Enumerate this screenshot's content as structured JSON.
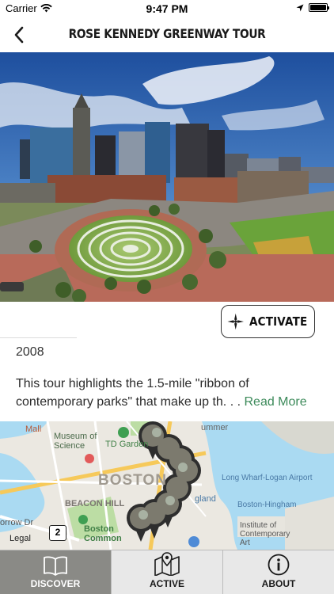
{
  "status_bar": {
    "carrier": "Carrier",
    "time": "9:47 PM",
    "battery_level": 1.0
  },
  "nav": {
    "title": "ROSE KENNEDY GREENWAY TOUR",
    "back_icon": "chevron-left-icon"
  },
  "hero": {
    "icon": "photo"
  },
  "actions": {
    "activate_label": "ACTIVATE",
    "activate_icon": "compass-icon"
  },
  "tour": {
    "year": "2008",
    "description": "This tour highlights the 1.5-mile \"ribbon of contemporary parks\" that make up th. . .",
    "read_more": "Read More"
  },
  "map": {
    "labels": {
      "mall": "Mall",
      "museum_of_science": "Museum of\nScience",
      "td_garden": "TD Garden",
      "boston": "BOSTON",
      "beacon_hill": "BEACON HILL",
      "long_wharf": "Long Wharf-Logan Airport",
      "boston_hingham": "Boston-Hingham",
      "england": "gland",
      "boston_common": "Boston\nCommon",
      "institute": "Institute of\nContemporary\nArt",
      "morrow": "orrow Dr",
      "summer": "ummer",
      "legal": "Legal"
    },
    "cluster_count": "2"
  },
  "tabs": [
    {
      "label": "DISCOVER",
      "icon": "book-icon",
      "selected": true
    },
    {
      "label": "ACTIVE",
      "icon": "map-pin-icon",
      "selected": false
    },
    {
      "label": "ABOUT",
      "icon": "info-icon",
      "selected": false
    }
  ],
  "colors": {
    "accent_green": "#3c8a5a",
    "tab_selected": "#8a8a86",
    "tab_unselected": "#e8e8e8"
  }
}
